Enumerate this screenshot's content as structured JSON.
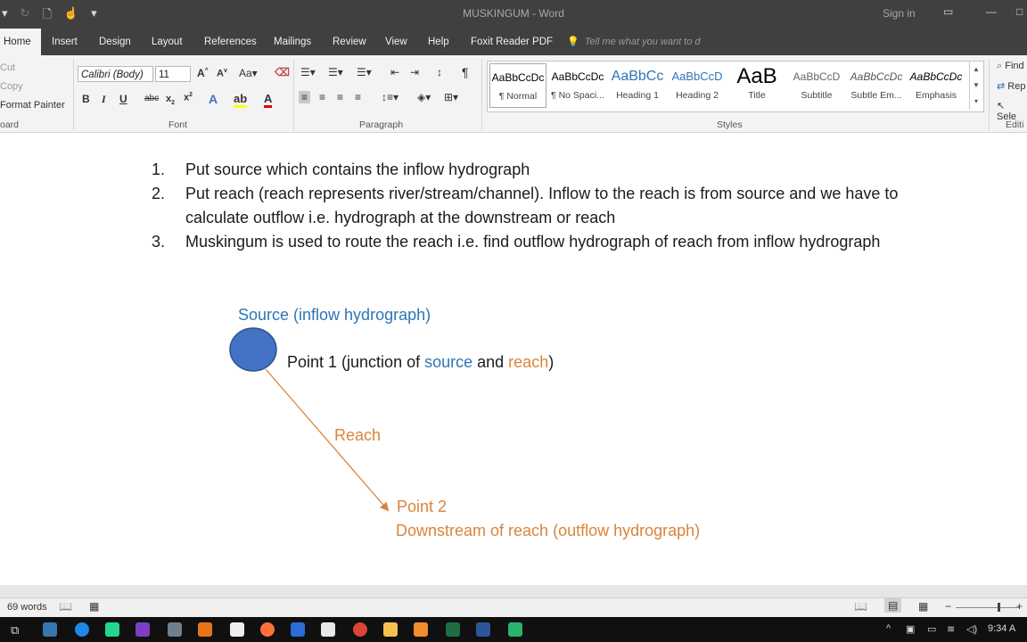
{
  "window": {
    "title": "MUSKINGUM  -  Word",
    "sign_in": "Sign in"
  },
  "tabs": [
    {
      "label": "Home"
    },
    {
      "label": "Insert"
    },
    {
      "label": "Design"
    },
    {
      "label": "Layout"
    },
    {
      "label": "References"
    },
    {
      "label": "Mailings"
    },
    {
      "label": "Review"
    },
    {
      "label": "View"
    },
    {
      "label": "Help"
    },
    {
      "label": "Foxit Reader PDF"
    }
  ],
  "tell_me": "Tell me what you want to d",
  "clipboard": {
    "cut": "Cut",
    "copy": "Copy",
    "format_painter": "Format Painter",
    "group": "oard"
  },
  "font": {
    "name": "Calibri (Body)",
    "size": "11",
    "group": "Font"
  },
  "paragraph": {
    "group": "Paragraph"
  },
  "styles": {
    "group": "Styles",
    "items": [
      {
        "sample": "AaBbCcDc",
        "name": "¶ Normal"
      },
      {
        "sample": "AaBbCcDc",
        "name": "¶ No Spaci..."
      },
      {
        "sample": "AaBbCc",
        "name": "Heading 1"
      },
      {
        "sample": "AaBbCcD",
        "name": "Heading 2"
      },
      {
        "sample": "AaB",
        "name": "Title"
      },
      {
        "sample": "AaBbCcD",
        "name": "Subtitle"
      },
      {
        "sample": "AaBbCcDc",
        "name": "Subtle Em..."
      },
      {
        "sample": "AaBbCcDc",
        "name": "Emphasis"
      }
    ]
  },
  "editing": {
    "find": "Find",
    "replace": "Rep",
    "select": "Sele",
    "group": "Editi"
  },
  "document": {
    "list": [
      {
        "num": "1.",
        "text": "Put source which contains the inflow hydrograph"
      },
      {
        "num": "2.",
        "text": "Put reach (reach represents river/stream/channel). Inflow to the reach is from source and we have to calculate outflow i.e. hydrograph at the downstream or reach"
      },
      {
        "num": "3.",
        "text": "Muskingum is used to route the reach i.e. find outflow hydrograph of reach from inflow hydrograph"
      }
    ],
    "diagram": {
      "source_label": "Source (inflow hydrograph)",
      "point1_prefix": "Point 1 (junction of ",
      "point1_source": "source",
      "point1_and": " and ",
      "point1_reach": "reach",
      "point1_suffix": ")",
      "reach_label": "Reach",
      "point2_label": "Point 2",
      "downstream_label": "Downstream of reach (outflow hydrograph)",
      "colors": {
        "node": "#4472c4",
        "orange": "#d9843b",
        "blue": "#2e75b6"
      }
    }
  },
  "status": {
    "words": "69 words"
  },
  "clock": "9:34 A"
}
